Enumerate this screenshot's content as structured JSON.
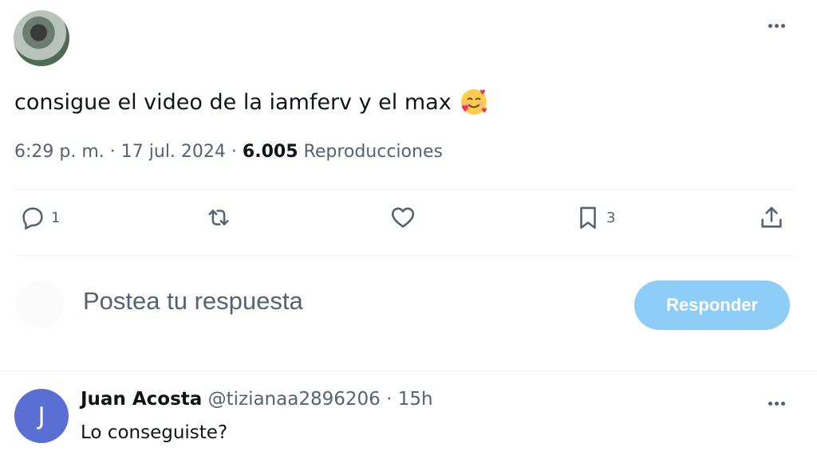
{
  "tweet": {
    "text": "consigue el video de la iamferv y el max",
    "emoji_icon": "smiling-face-with-hearts",
    "time": "6:29 p. m.",
    "separator": "·",
    "date": "17 jul. 2024",
    "views_count": "6.005",
    "views_label": "Reproducciones"
  },
  "actions": {
    "replies_count": "1",
    "bookmarks_count": "3"
  },
  "reply": {
    "placeholder": "Postea tu respuesta",
    "button_label": "Responder"
  },
  "comment": {
    "avatar_letter": "J",
    "name": "Juan Acosta",
    "handle": "@tizianaa2896206",
    "separator": "·",
    "time": "15h",
    "text": "Lo conseguiste?"
  },
  "colors": {
    "text_primary": "#0f1419",
    "text_secondary": "#536471",
    "reply_button_disabled": "#8ecdf7",
    "comment_avatar": "#5b6ed3"
  }
}
